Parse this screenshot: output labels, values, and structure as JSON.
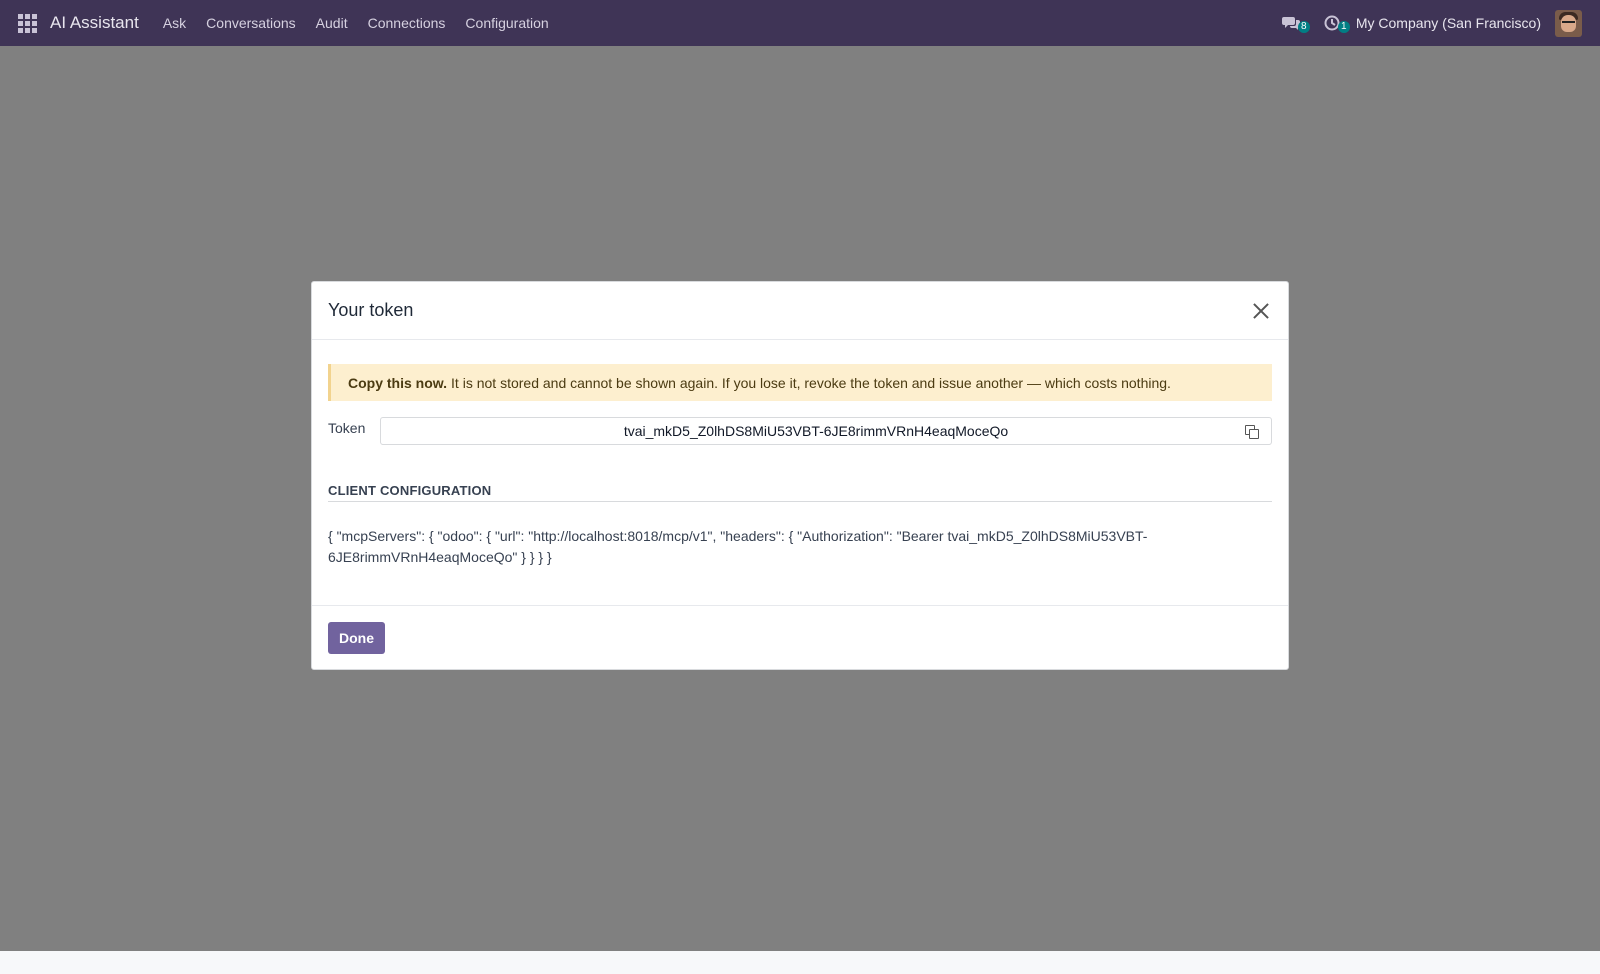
{
  "navbar": {
    "app_name": "AI Assistant",
    "menu": [
      "Ask",
      "Conversations",
      "Audit",
      "Connections",
      "Configuration"
    ],
    "messages_count": "8",
    "activities_count": "1",
    "company": "My Company (San Francisco)",
    "accent_color": "#3f3456"
  },
  "dialog": {
    "title": "Your token",
    "alert": {
      "bold": "Copy this now.",
      "text": "It is not stored and cannot be shown again. If you lose it, revoke the token and issue another — which costs nothing."
    },
    "token_label": "Token",
    "token_value": "tvai_mkD5_Z0lhDS8MiU53VBT-6JE8rimmVRnH4eaqMoceQo",
    "section_heading": "CLIENT CONFIGURATION",
    "config_text": "{ \"mcpServers\": { \"odoo\": { \"url\": \"http://localhost:8018/mcp/v1\", \"headers\": { \"Authorization\": \"Bearer tvai_mkD5_Z0lhDS8MiU53VBT-6JE8rimmVRnH4eaqMoceQo\" } } } }",
    "done_label": "Done",
    "primary_color": "#71639e"
  }
}
